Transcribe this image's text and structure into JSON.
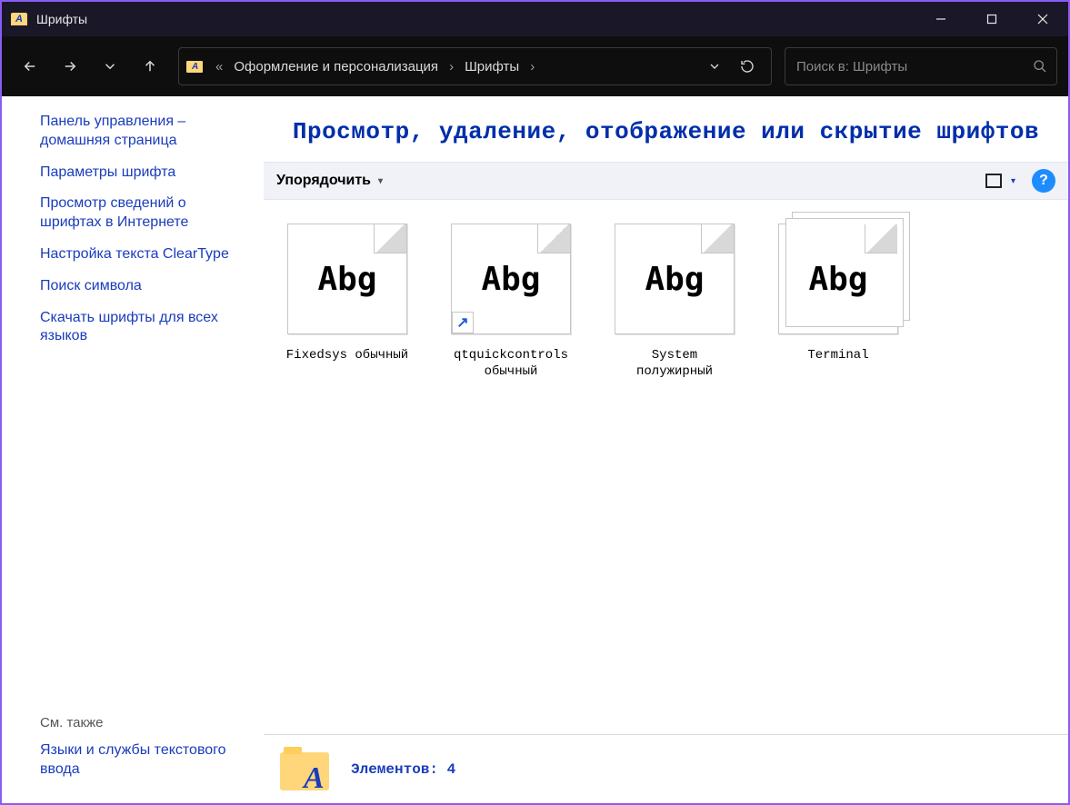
{
  "titlebar": {
    "title": "Шрифты"
  },
  "breadcrumb": {
    "prefix": "«",
    "items": [
      "Оформление и персонализация",
      "Шрифты"
    ]
  },
  "search": {
    "placeholder": "Поиск в: Шрифты"
  },
  "sidenav": {
    "items": [
      "Панель управления – домашняя страница",
      "Параметры шрифта",
      "Просмотр сведений о шрифтах в Интернете",
      "Настройка текста ClearType",
      "Поиск символа",
      "Скачать шрифты для всех языков"
    ],
    "see_also_label": "См. также",
    "see_also_items": [
      "Языки и службы текстового ввода"
    ]
  },
  "heading": "Просмотр, удаление, отображение или скрытие шрифтов",
  "toolbar": {
    "organize": "Упорядочить",
    "help": "?"
  },
  "fonts": [
    {
      "name": "Fixedsys обычный",
      "preview": "Abg",
      "shortcut": false,
      "family": false
    },
    {
      "name": "qtquickcontrols обычный",
      "preview": "Abg",
      "shortcut": true,
      "family": false
    },
    {
      "name": "System полужирный",
      "preview": "Abg",
      "shortcut": false,
      "family": false
    },
    {
      "name": "Terminal",
      "preview": "Abg",
      "shortcut": false,
      "family": true
    }
  ],
  "status": {
    "label": "Элементов:",
    "count": "4"
  }
}
